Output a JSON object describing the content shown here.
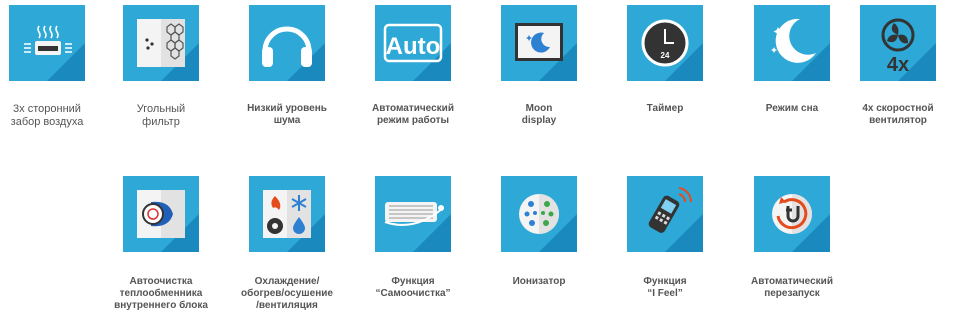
{
  "row1": [
    {
      "icon": "air-intake-icon",
      "label": "3х сторонний\nзабор воздуха",
      "bold": false
    },
    {
      "icon": "carbon-filter-icon",
      "label": "Угольный\nфильтр",
      "bold": false
    },
    {
      "icon": "headphones-icon",
      "label": "Низкий уровень\nшума",
      "bold": true
    },
    {
      "icon": "auto-mode-icon",
      "label": "Автоматический\nрежим работы",
      "bold": true
    },
    {
      "icon": "moon-display-icon",
      "label": "Moon\ndisplay",
      "bold": true
    },
    {
      "icon": "timer-icon",
      "label": "Таймер",
      "bold": true
    },
    {
      "icon": "sleep-mode-icon",
      "label": "Режим сна",
      "bold": true
    },
    {
      "icon": "fan-4x-icon",
      "label": "4х скоростной\nвентилятор",
      "bold": true
    }
  ],
  "row2": [
    {
      "icon": "heat-exchanger-clean-icon",
      "label": "Автоочистка\nтеплообменника\nвнутреннего блока",
      "bold": true
    },
    {
      "icon": "climate-modes-icon",
      "label": "Охлаждение/\nобогрев/осушение\n/вентиляция",
      "bold": true
    },
    {
      "icon": "self-clean-icon",
      "label": "Функция\n“Самоочистка”",
      "bold": true
    },
    {
      "icon": "ionizer-icon",
      "label": "Ионизатор",
      "bold": true
    },
    {
      "icon": "i-feel-icon",
      "label": "Функция\n“I Feel”",
      "bold": true
    },
    {
      "icon": "auto-restart-icon",
      "label": "Автоматический\nперезапуск",
      "bold": true
    }
  ],
  "glyph_text": {
    "auto": "Auto",
    "timer": "24",
    "fan_speed": "4x"
  },
  "colors": {
    "tile": "#2ea8d6",
    "tile_shadow": "#1a89bd",
    "label": "#555555"
  }
}
